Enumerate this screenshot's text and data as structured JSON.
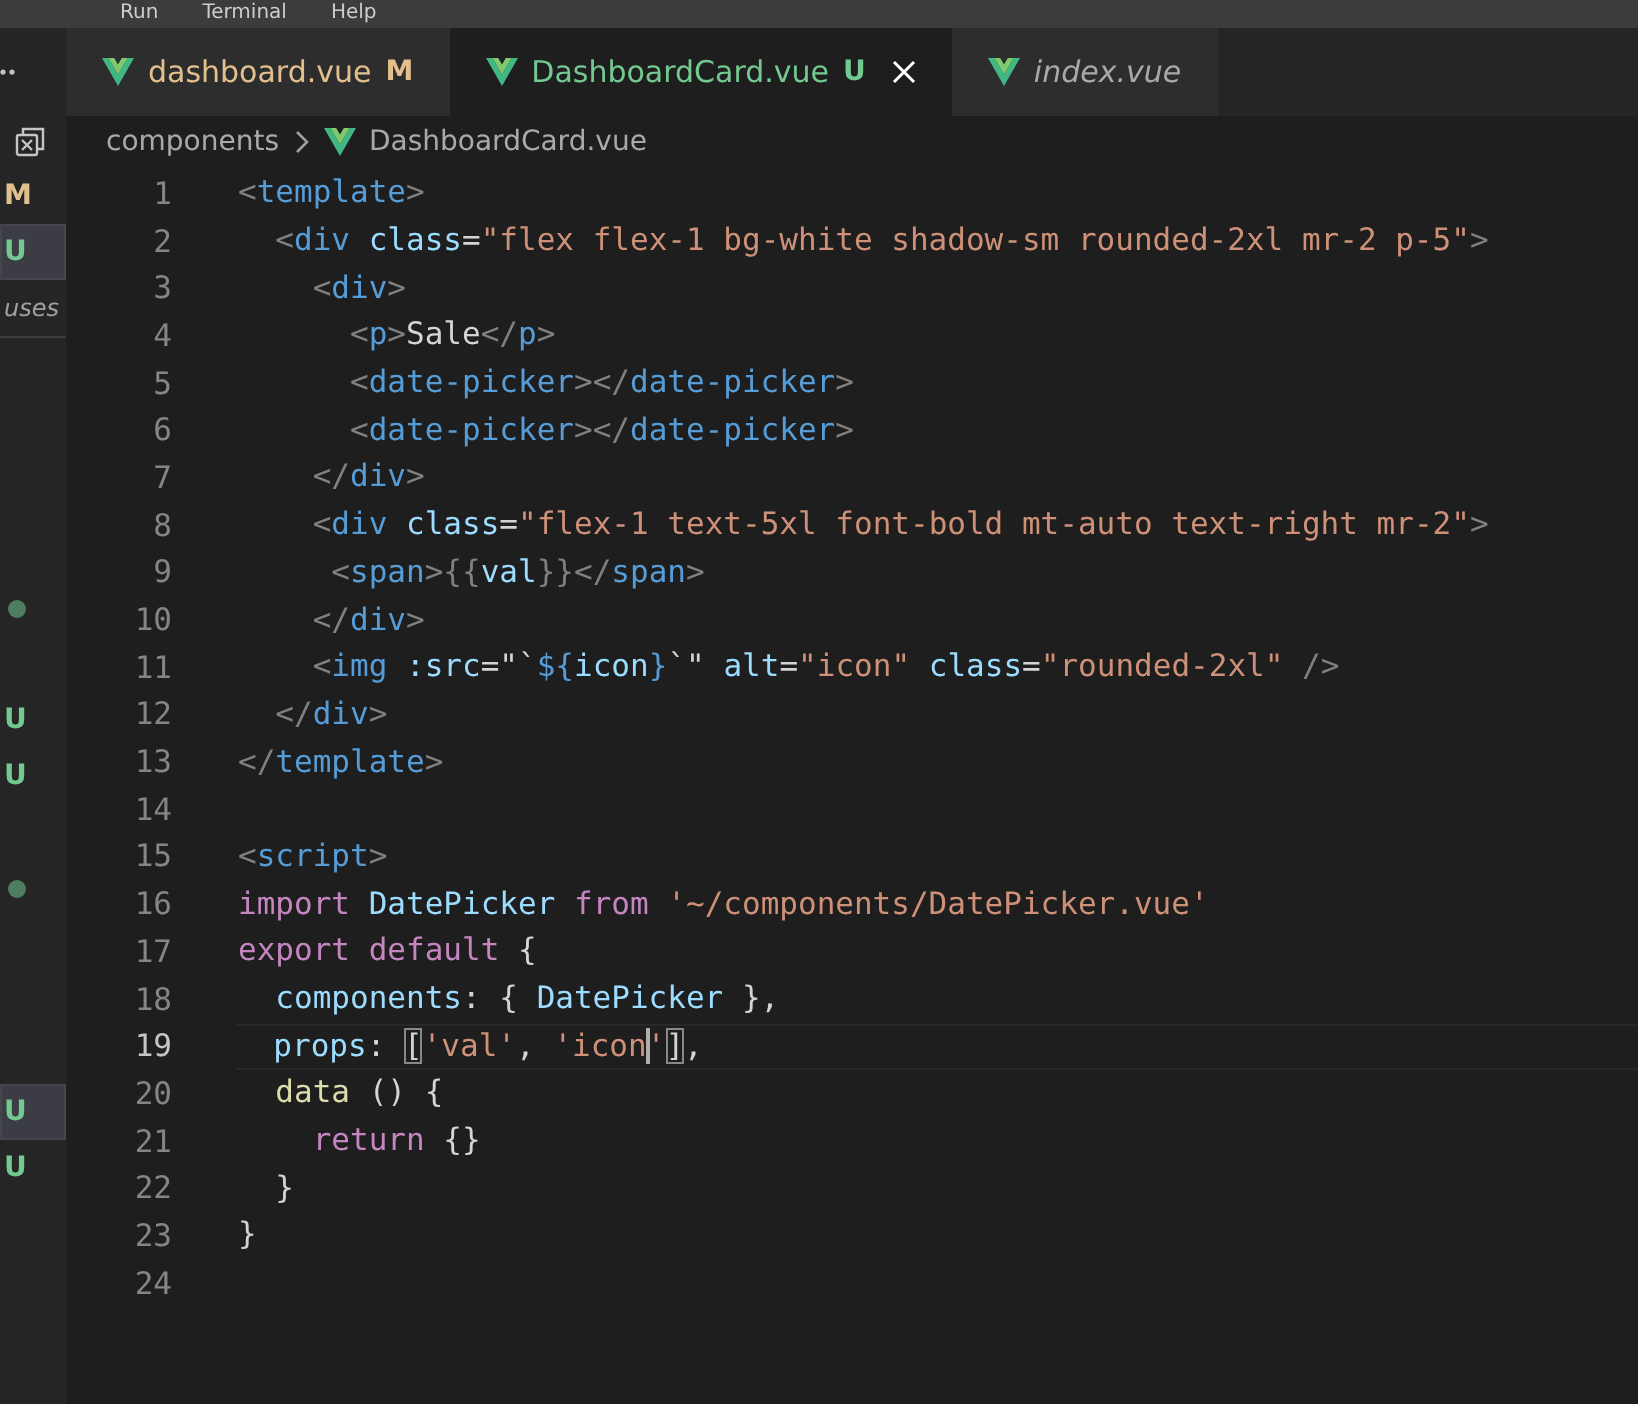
{
  "menu": [
    "Run",
    "Terminal",
    "Help"
  ],
  "tabs": [
    {
      "label": "dashboard.vue",
      "badge": "M",
      "color": "#e2c08d",
      "selected": false,
      "preview": false
    },
    {
      "label": "DashboardCard.vue",
      "badge": "U",
      "color": "#73c991",
      "selected": true,
      "preview": false
    },
    {
      "label": "index.vue",
      "color": "#a9a9a9",
      "selected": false,
      "preview": true
    }
  ],
  "breadcrumb": {
    "folder": "components",
    "file": "DashboardCard.vue"
  },
  "open_editors": [
    {
      "kind": "badge",
      "text": "M",
      "color": "#e2c08d",
      "selected": false
    },
    {
      "kind": "badge",
      "text": "U",
      "color": "#73c991",
      "selected": true
    },
    {
      "kind": "name",
      "text": "uses",
      "selected": false
    }
  ],
  "tree": [
    {
      "kind": "blank"
    },
    {
      "kind": "blank"
    },
    {
      "kind": "blank"
    },
    {
      "kind": "blank"
    },
    {
      "kind": "dot",
      "color": "#4f7d5f",
      "selected": false
    },
    {
      "kind": "blank"
    },
    {
      "kind": "badge",
      "text": "U",
      "color": "#73c991",
      "selected": false
    },
    {
      "kind": "badge",
      "text": "U",
      "color": "#73c991",
      "selected": false
    },
    {
      "kind": "blank"
    },
    {
      "kind": "dot",
      "color": "#4f7d5f",
      "selected": false
    },
    {
      "kind": "blank"
    },
    {
      "kind": "blank"
    },
    {
      "kind": "blank"
    },
    {
      "kind": "badge",
      "text": "U",
      "color": "#73c991",
      "selected": true
    },
    {
      "kind": "badge",
      "text": "U",
      "color": "#73c991",
      "selected": false
    }
  ],
  "code": [
    {
      "number": "1",
      "current": false,
      "tokens": [
        {
          "kind": "angle",
          "text": "<"
        },
        {
          "kind": "tag",
          "text": "template"
        },
        {
          "kind": "angle",
          "text": ">"
        }
      ]
    },
    {
      "number": "2",
      "current": false,
      "tokens": [
        {
          "kind": "angle",
          "text": "  <"
        },
        {
          "kind": "tag",
          "text": "div"
        },
        {
          "kind": "attr",
          "text": " class"
        },
        {
          "kind": "op",
          "text": "="
        },
        {
          "kind": "str",
          "text": "\"flex flex-1 bg-white shadow-sm rounded-2xl mr-2 p-5\""
        },
        {
          "kind": "angle",
          "text": ">"
        }
      ]
    },
    {
      "number": "3",
      "current": false,
      "tokens": [
        {
          "kind": "angle",
          "text": "    <"
        },
        {
          "kind": "tag",
          "text": "div"
        },
        {
          "kind": "angle",
          "text": ">"
        }
      ]
    },
    {
      "number": "4",
      "current": false,
      "tokens": [
        {
          "kind": "angle",
          "text": "      <"
        },
        {
          "kind": "tag",
          "text": "p"
        },
        {
          "kind": "angle",
          "text": ">"
        },
        {
          "kind": "text",
          "text": "Sale"
        },
        {
          "kind": "angle",
          "text": "</"
        },
        {
          "kind": "tag",
          "text": "p"
        },
        {
          "kind": "angle",
          "text": ">"
        }
      ]
    },
    {
      "number": "5",
      "current": false,
      "tokens": [
        {
          "kind": "angle",
          "text": "      <"
        },
        {
          "kind": "tag",
          "text": "date-picker"
        },
        {
          "kind": "angle",
          "text": "></"
        },
        {
          "kind": "tag",
          "text": "date-picker"
        },
        {
          "kind": "angle",
          "text": ">"
        }
      ]
    },
    {
      "number": "6",
      "current": false,
      "tokens": [
        {
          "kind": "angle",
          "text": "      <"
        },
        {
          "kind": "tag",
          "text": "date-picker"
        },
        {
          "kind": "angle",
          "text": "></"
        },
        {
          "kind": "tag",
          "text": "date-picker"
        },
        {
          "kind": "angle",
          "text": ">"
        }
      ]
    },
    {
      "number": "7",
      "current": false,
      "tokens": [
        {
          "kind": "angle",
          "text": "    </"
        },
        {
          "kind": "tag",
          "text": "div"
        },
        {
          "kind": "angle",
          "text": ">"
        }
      ]
    },
    {
      "number": "8",
      "current": false,
      "tokens": [
        {
          "kind": "angle",
          "text": "    <"
        },
        {
          "kind": "tag",
          "text": "div"
        },
        {
          "kind": "attr",
          "text": " class"
        },
        {
          "kind": "op",
          "text": "="
        },
        {
          "kind": "str",
          "text": "\"flex-1 text-5xl font-bold mt-auto text-right mr-2\""
        },
        {
          "kind": "angle",
          "text": ">"
        }
      ]
    },
    {
      "number": "9",
      "current": false,
      "tokens": [
        {
          "kind": "angle",
          "text": "     <"
        },
        {
          "kind": "tag",
          "text": "span"
        },
        {
          "kind": "angle",
          "text": ">{{"
        },
        {
          "kind": "attr",
          "text": "val"
        },
        {
          "kind": "angle",
          "text": "}}</"
        },
        {
          "kind": "tag",
          "text": "span"
        },
        {
          "kind": "angle",
          "text": ">"
        }
      ]
    },
    {
      "number": "10",
      "current": false,
      "tokens": [
        {
          "kind": "angle",
          "text": "    </"
        },
        {
          "kind": "tag",
          "text": "div"
        },
        {
          "kind": "angle",
          "text": ">"
        }
      ]
    },
    {
      "number": "11",
      "current": false,
      "tokens": [
        {
          "kind": "angle",
          "text": "    <"
        },
        {
          "kind": "tag",
          "text": "img"
        },
        {
          "kind": "attr",
          "text": " :src"
        },
        {
          "kind": "op",
          "text": "=\"`"
        },
        {
          "kind": "tag",
          "text": "${"
        },
        {
          "kind": "attr",
          "text": "icon"
        },
        {
          "kind": "tag",
          "text": "}"
        },
        {
          "kind": "op",
          "text": "`\""
        },
        {
          "kind": "attr",
          "text": " alt"
        },
        {
          "kind": "op",
          "text": "="
        },
        {
          "kind": "str",
          "text": "\"icon\""
        },
        {
          "kind": "attr",
          "text": " class"
        },
        {
          "kind": "op",
          "text": "="
        },
        {
          "kind": "str",
          "text": "\"rounded-2xl\""
        },
        {
          "kind": "angle",
          "text": " />"
        }
      ]
    },
    {
      "number": "12",
      "current": false,
      "tokens": [
        {
          "kind": "angle",
          "text": "  </"
        },
        {
          "kind": "tag",
          "text": "div"
        },
        {
          "kind": "angle",
          "text": ">"
        }
      ]
    },
    {
      "number": "13",
      "current": false,
      "tokens": [
        {
          "kind": "angle",
          "text": "</"
        },
        {
          "kind": "tag",
          "text": "template"
        },
        {
          "kind": "angle",
          "text": ">"
        }
      ]
    },
    {
      "number": "14",
      "current": false
    },
    {
      "number": "15",
      "current": false,
      "tokens": [
        {
          "kind": "angle",
          "text": "<"
        },
        {
          "kind": "tag",
          "text": "script"
        },
        {
          "kind": "angle",
          "text": ">"
        }
      ]
    },
    {
      "number": "16",
      "current": false,
      "tokens": [
        {
          "kind": "kw",
          "text": "import"
        },
        {
          "kind": "var",
          "text": " DatePicker"
        },
        {
          "kind": "kw",
          "text": " from"
        },
        {
          "kind": "str",
          "text": " '~/components/DatePicker.vue'"
        }
      ]
    },
    {
      "number": "17",
      "current": false,
      "tokens": [
        {
          "kind": "kw",
          "text": "export default"
        },
        {
          "kind": "brace",
          "text": " {"
        }
      ]
    },
    {
      "number": "18",
      "current": false,
      "tokens": [
        {
          "kind": "var",
          "text": "  components"
        },
        {
          "kind": "op",
          "text": ": {"
        },
        {
          "kind": "var",
          "text": " DatePicker"
        },
        {
          "kind": "op",
          "text": " },"
        }
      ]
    },
    {
      "number": "19",
      "current": true,
      "tokens": [
        {
          "kind": "var",
          "text": "  props"
        },
        {
          "kind": "op",
          "text": ": "
        },
        {
          "kind": "match",
          "text": "["
        },
        {
          "kind": "str",
          "text": "'val'"
        },
        {
          "kind": "op",
          "text": ", "
        },
        {
          "kind": "str",
          "text": "'icon"
        },
        {
          "kind": "cursor"
        },
        {
          "kind": "str",
          "text": "'"
        },
        {
          "kind": "match",
          "text": "]"
        },
        {
          "kind": "op",
          "text": ","
        }
      ]
    },
    {
      "number": "20",
      "current": false,
      "tokens": [
        {
          "kind": "fn",
          "text": "  data"
        },
        {
          "kind": "brace",
          "text": " () {"
        }
      ]
    },
    {
      "number": "21",
      "current": false,
      "tokens": [
        {
          "kind": "kw",
          "text": "    return"
        },
        {
          "kind": "brace",
          "text": " {}"
        }
      ]
    },
    {
      "number": "22",
      "current": false,
      "tokens": [
        {
          "kind": "brace",
          "text": "  }"
        }
      ]
    },
    {
      "number": "23",
      "current": false,
      "tokens": [
        {
          "kind": "brace",
          "text": "}"
        }
      ]
    },
    {
      "number": "24",
      "current": false
    }
  ]
}
